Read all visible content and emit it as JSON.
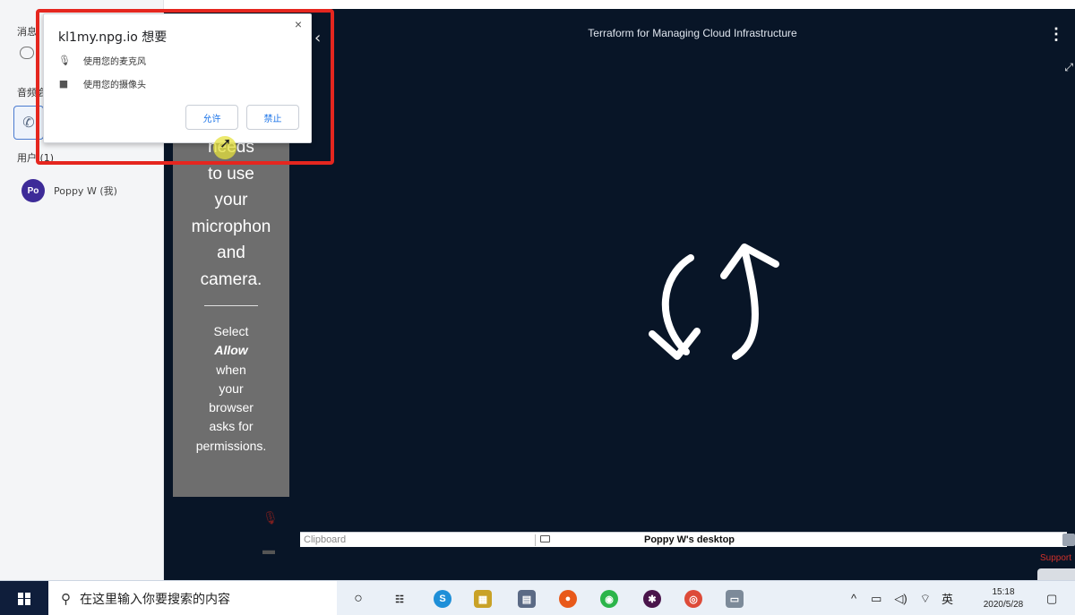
{
  "sidebar": {
    "messages_heading": "消息",
    "audio_heading": "音频会",
    "users_heading": "用户 (1)",
    "user": {
      "initials": "Po",
      "name": "Poppy W (我)"
    }
  },
  "stage": {
    "title": "Terraform for Managing Cloud Infrastructure",
    "permission_lines": [
      "needs",
      "to use",
      "your",
      "microphon",
      "and",
      "camera."
    ],
    "instruction_pre": [
      "Select"
    ],
    "instruction_bold": "Allow",
    "instruction_post": [
      "when",
      "your",
      "browser",
      "asks for",
      "permissions."
    ]
  },
  "popup": {
    "title": "kl1my.npg.io 想要",
    "mic_text": "使用您的麦克风",
    "cam_text": "使用您的摄像头",
    "allow_label": "允许",
    "block_label": "禁止",
    "close_symbol": "×"
  },
  "bottom_bar": {
    "clipboard_placeholder": "Clipboard",
    "desktop_label": "Poppy W's desktop",
    "support_label": "Support"
  },
  "taskbar": {
    "search_placeholder": "在这里输入你要搜索的内容",
    "language": "英",
    "time": "15:18",
    "date": "2020/5/28"
  },
  "colors": {
    "stage_bg": "#081527",
    "annotation_red": "#e5261f",
    "avatar": "#3d2b98",
    "link_blue": "#1a73e8"
  }
}
